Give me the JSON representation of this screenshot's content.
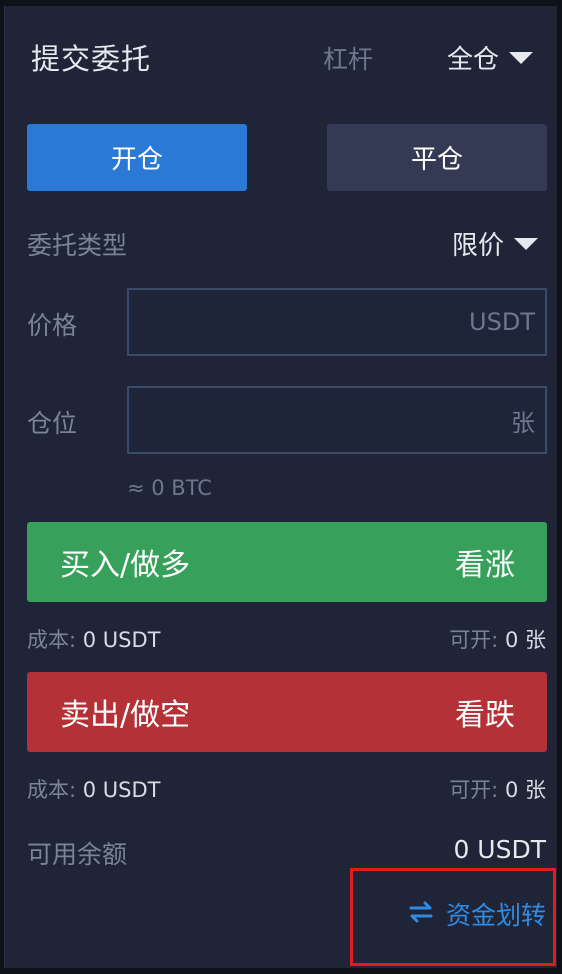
{
  "header": {
    "title": "提交委托",
    "leverage_label": "杠杆",
    "margin_mode": "全仓"
  },
  "tabs": {
    "open_label": "开仓",
    "close_label": "平仓"
  },
  "order_type": {
    "label": "委托类型",
    "value": "限价"
  },
  "price": {
    "label": "价格",
    "value": "",
    "unit": "USDT"
  },
  "quantity": {
    "label": "仓位",
    "value": "",
    "unit": "张"
  },
  "estimate": "≈ 0 BTC",
  "buy": {
    "label": "买入/做多",
    "direction": "看涨",
    "cost_label": "成本:",
    "cost_value": "0 USDT",
    "avail_label": "可开:",
    "avail_value": "0 张"
  },
  "sell": {
    "label": "卖出/做空",
    "direction": "看跌",
    "cost_label": "成本:",
    "cost_value": "0 USDT",
    "avail_label": "可开:",
    "avail_value": "0 张"
  },
  "balance": {
    "label": "可用余额",
    "value": "0 USDT"
  },
  "transfer": {
    "label": "资金划转",
    "icon": "transfer-icon"
  },
  "colors": {
    "background": "#1f2436",
    "open_tab": "#2a79d6",
    "close_tab": "#343a54",
    "buy": "#37a05a",
    "sell": "#b33137",
    "link": "#2f8be6",
    "highlight": "#e21b1b"
  }
}
